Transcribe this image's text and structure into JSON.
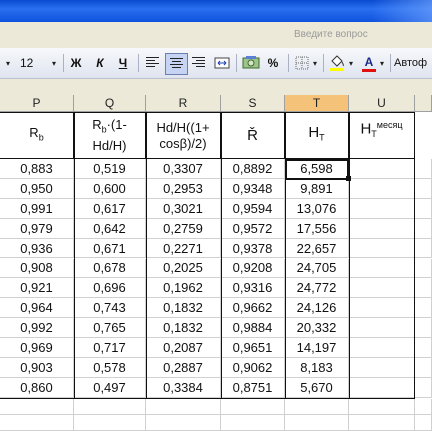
{
  "help": {
    "ask_placeholder": "Введите вопрос"
  },
  "toolbar": {
    "font_size": "12",
    "bold": "Ж",
    "italic": "К",
    "underline": "Ч",
    "percent": "%",
    "autoformat": "Автоф",
    "font_color_letter": "A",
    "font_color": "#e01010",
    "fill_color": "#ffff00"
  },
  "columns": [
    {
      "id": "P",
      "label": "P"
    },
    {
      "id": "Q",
      "label": "Q"
    },
    {
      "id": "R",
      "label": "R"
    },
    {
      "id": "S",
      "label": "S"
    },
    {
      "id": "T",
      "label": "T",
      "active": true
    },
    {
      "id": "U",
      "label": "U"
    }
  ],
  "headers": {
    "p": {
      "main": "R",
      "sub": "b"
    },
    "q": {
      "main": "R",
      "sub": "b",
      "rest1": "·(1-",
      "rest2": "Hd/H)"
    },
    "r": {
      "line1": "Hd/H((1+",
      "line2": "cosβ)/2)"
    },
    "s": {
      "main": "Ř"
    },
    "t": {
      "main": "H",
      "sub": "T"
    },
    "u": {
      "main": "H",
      "sub": "T",
      "sup": "месяц"
    }
  },
  "rows": [
    [
      "0,883",
      "0,519",
      "0,3307",
      "0,8892",
      "6,598"
    ],
    [
      "0,950",
      "0,600",
      "0,2953",
      "0,9348",
      "9,891"
    ],
    [
      "0,991",
      "0,617",
      "0,3021",
      "0,9594",
      "13,076"
    ],
    [
      "0,979",
      "0,642",
      "0,2759",
      "0,9572",
      "17,556"
    ],
    [
      "0,936",
      "0,671",
      "0,2271",
      "0,9378",
      "22,657"
    ],
    [
      "0,908",
      "0,678",
      "0,2025",
      "0,9208",
      "24,705"
    ],
    [
      "0,921",
      "0,696",
      "0,1962",
      "0,9316",
      "24,772"
    ],
    [
      "0,964",
      "0,743",
      "0,1832",
      "0,9662",
      "24,126"
    ],
    [
      "0,992",
      "0,765",
      "0,1832",
      "0,9884",
      "20,332"
    ],
    [
      "0,969",
      "0,717",
      "0,2087",
      "0,9651",
      "14,197"
    ],
    [
      "0,903",
      "0,578",
      "0,2887",
      "0,9062",
      "8,183"
    ],
    [
      "0,860",
      "0,497",
      "0,3384",
      "0,8751",
      "5,670"
    ]
  ]
}
